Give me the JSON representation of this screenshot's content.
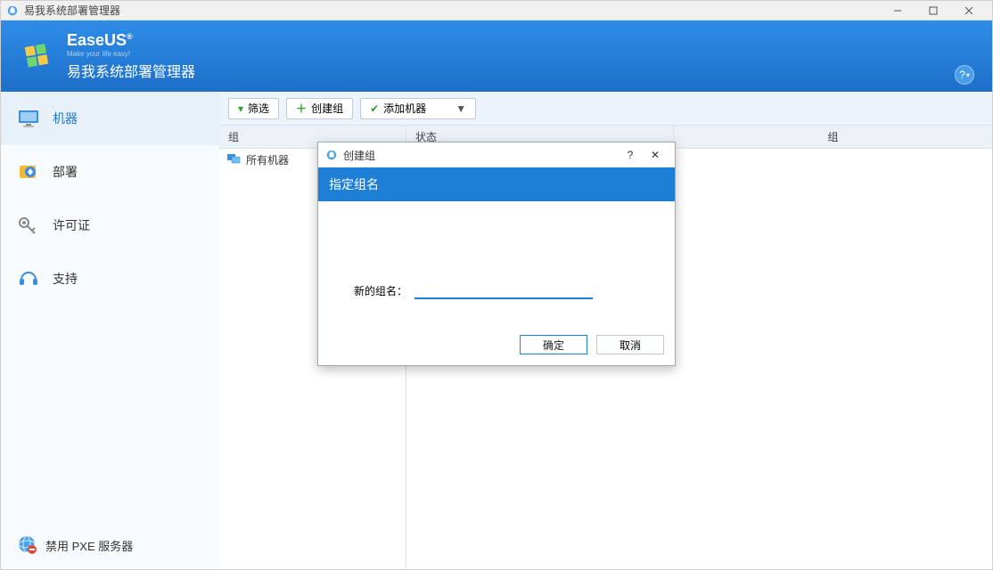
{
  "window": {
    "title": "易我系统部署管理器"
  },
  "brand": {
    "name": "EaseUS",
    "tagline": "Make your life easy!",
    "subtitle": "易我系统部署管理器"
  },
  "sidebar": {
    "items": [
      {
        "label": "机器"
      },
      {
        "label": "部署"
      },
      {
        "label": "许可证"
      },
      {
        "label": "支持"
      }
    ],
    "footer_label": "禁用 PXE 服务器"
  },
  "toolbar": {
    "filter_label": "筛选",
    "create_group_label": "创建组",
    "add_machine_label": "添加机器"
  },
  "panes": {
    "group_col": "组",
    "all_machines": "所有机器",
    "status_col": "状态",
    "group_col2": "组"
  },
  "dialog": {
    "title": "创建组",
    "band": "指定组名",
    "field_label": "新的组名：",
    "input_value": "",
    "ok": "确定",
    "cancel": "取消"
  }
}
